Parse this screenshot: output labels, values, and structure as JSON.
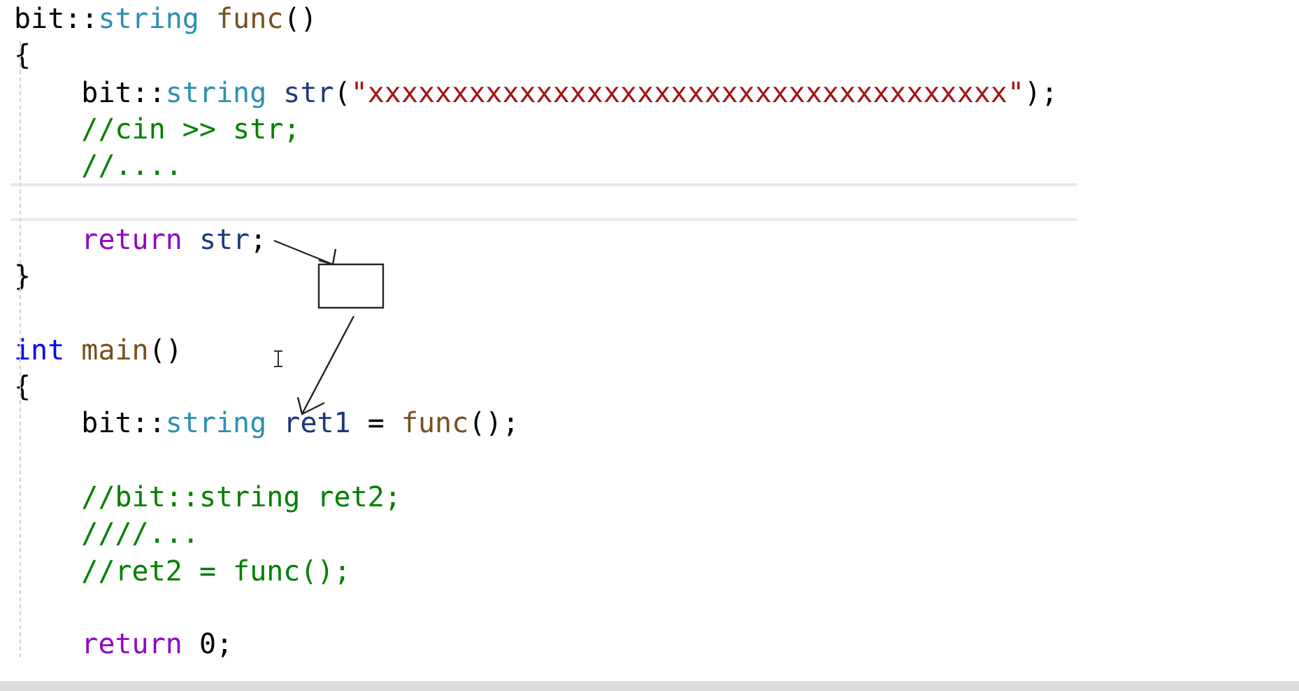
{
  "editor": {
    "lines": [
      {
        "highlighted": false,
        "tokens": [
          {
            "kind": "plain",
            "text": "bit::"
          },
          {
            "kind": "type",
            "text": "string"
          },
          {
            "kind": "function",
            "text": " func"
          },
          {
            "kind": "plain",
            "text": "()"
          }
        ]
      },
      {
        "highlighted": false,
        "tokens": [
          {
            "kind": "plain",
            "text": "{"
          }
        ]
      },
      {
        "highlighted": false,
        "tokens": [
          {
            "kind": "plain",
            "text": "    bit::"
          },
          {
            "kind": "type",
            "text": "string"
          },
          {
            "kind": "variable",
            "text": " str"
          },
          {
            "kind": "plain",
            "text": "("
          },
          {
            "kind": "string",
            "text": "\"xxxxxxxxxxxxxxxxxxxxxxxxxxxxxxxxxxxxxx\""
          },
          {
            "kind": "plain",
            "text": ");"
          }
        ]
      },
      {
        "highlighted": false,
        "tokens": [
          {
            "kind": "comment",
            "text": "    //cin >> str;"
          }
        ]
      },
      {
        "highlighted": false,
        "tokens": [
          {
            "kind": "comment",
            "text": "    //...."
          }
        ]
      },
      {
        "highlighted": true
      },
      {
        "highlighted": false,
        "tokens": [
          {
            "kind": "keyword",
            "text": "    return"
          },
          {
            "kind": "variable",
            "text": " str"
          },
          {
            "kind": "plain",
            "text": ";"
          }
        ]
      },
      {
        "highlighted": false,
        "tokens": [
          {
            "kind": "plain",
            "text": "}"
          }
        ]
      },
      {
        "highlighted": false
      },
      {
        "highlighted": false,
        "tokens": [
          {
            "kind": "builtin",
            "text": "int"
          },
          {
            "kind": "function",
            "text": " main"
          },
          {
            "kind": "plain",
            "text": "()"
          }
        ]
      },
      {
        "highlighted": false,
        "tokens": [
          {
            "kind": "plain",
            "text": "{"
          }
        ]
      },
      {
        "highlighted": false,
        "tokens": [
          {
            "kind": "plain",
            "text": "    bit::"
          },
          {
            "kind": "type",
            "text": "string"
          },
          {
            "kind": "variable",
            "text": " ret1"
          },
          {
            "kind": "plain",
            "text": " = "
          },
          {
            "kind": "function",
            "text": "func"
          },
          {
            "kind": "plain",
            "text": "();"
          }
        ]
      },
      {
        "highlighted": false
      },
      {
        "highlighted": false,
        "tokens": [
          {
            "kind": "comment",
            "text": "    //bit::string ret2;"
          }
        ]
      },
      {
        "highlighted": false,
        "tokens": [
          {
            "kind": "comment",
            "text": "    ////..."
          }
        ]
      },
      {
        "highlighted": false,
        "tokens": [
          {
            "kind": "comment",
            "text": "    //ret2 = func();"
          }
        ]
      },
      {
        "highlighted": false
      },
      {
        "highlighted": false,
        "tokens": [
          {
            "kind": "keyword",
            "text": "    return"
          },
          {
            "kind": "plain",
            "text": " 0;"
          }
        ]
      }
    ]
  }
}
